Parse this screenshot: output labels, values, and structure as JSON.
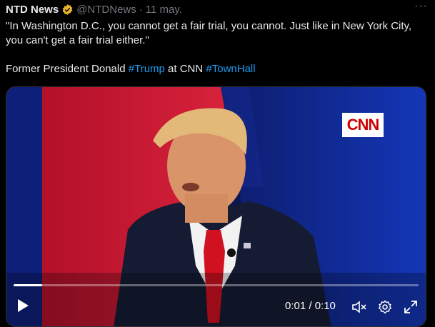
{
  "tweet": {
    "author_name": "NTD News",
    "handle": "@NTDNews",
    "separator": "·",
    "date": "11 may.",
    "more": "···",
    "quote_line": "\"In Washington D.C., you cannot get a fair trial, you cannot. Just like in New York City, you can't get a fair trial either.\"",
    "caption_prefix": "Former President Donald ",
    "hashtag1": "#Trump",
    "caption_middle": " at CNN ",
    "hashtag2": "#TownHall"
  },
  "video": {
    "logo_text": "CNN",
    "time": "0:01 / 0:10",
    "progress": 0.07
  },
  "colors": {
    "background": "#000000",
    "text": "#e7e9ea",
    "muted": "#71767b",
    "link": "#1d9bf0",
    "verified_badge": "#e8b32a"
  },
  "icons": [
    "verified-badge-icon",
    "more-icon",
    "play-icon",
    "mute-icon",
    "settings-icon",
    "fullscreen-icon"
  ]
}
